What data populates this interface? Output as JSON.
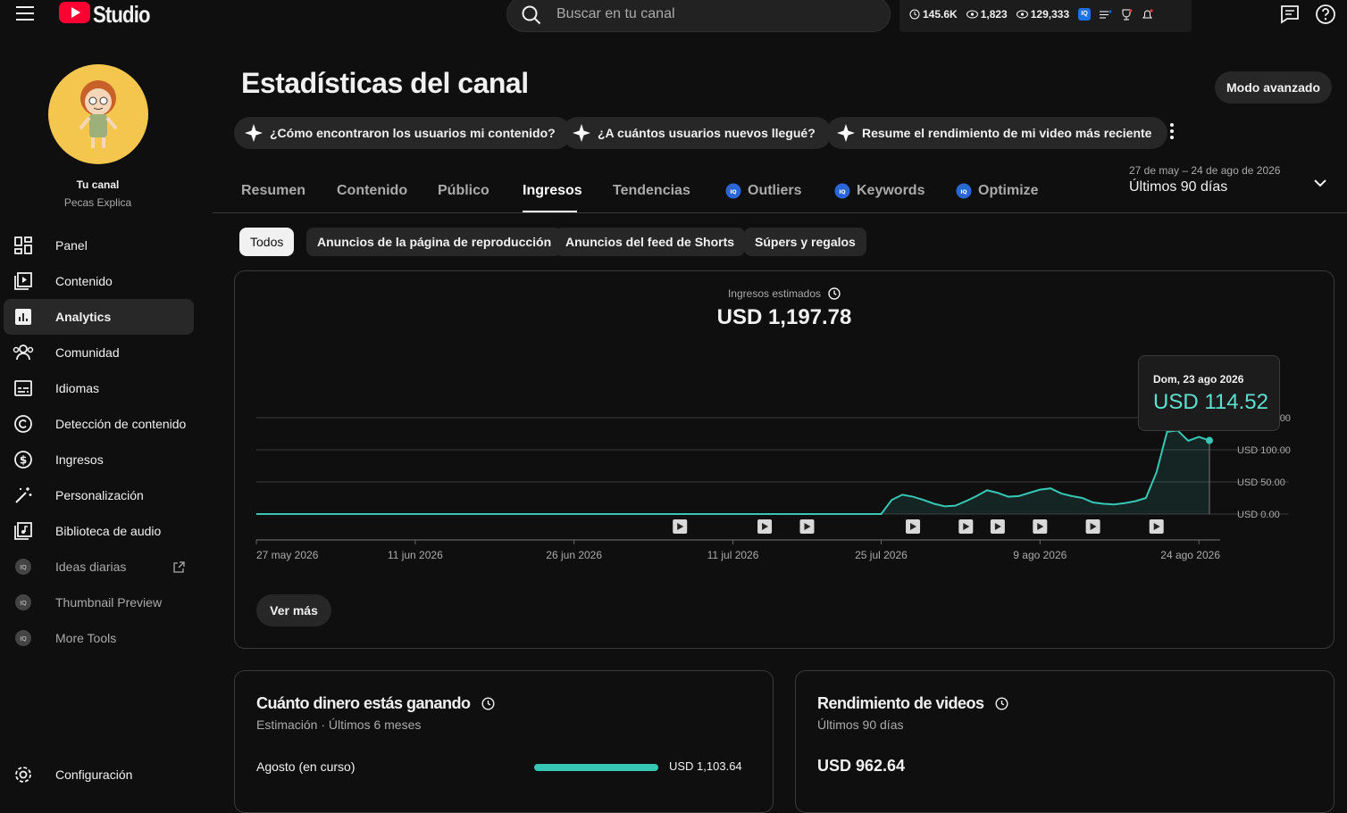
{
  "header": {
    "logo_text": "Studio",
    "search_placeholder": "Buscar en tu canal",
    "stats": {
      "subs": "145.6K",
      "views_a": "1,823",
      "views_b": "129,333",
      "ext_badge": "IQ"
    }
  },
  "channel": {
    "title": "Tu canal",
    "name": "Pecas Explica"
  },
  "sidebar": {
    "items": [
      {
        "label": "Panel",
        "icon": "dashboard-icon"
      },
      {
        "label": "Contenido",
        "icon": "content-icon"
      },
      {
        "label": "Analytics",
        "icon": "analytics-icon",
        "active": true
      },
      {
        "label": "Comunidad",
        "icon": "community-icon"
      },
      {
        "label": "Idiomas",
        "icon": "subtitles-icon"
      },
      {
        "label": "Detección de contenido",
        "icon": "copyright-icon"
      },
      {
        "label": "Ingresos",
        "icon": "dollar-icon"
      },
      {
        "label": "Personalización",
        "icon": "magic-wand-icon"
      },
      {
        "label": "Biblioteca de audio",
        "icon": "audio-library-icon"
      },
      {
        "label": "Ideas diarias",
        "icon": "iq-icon"
      },
      {
        "label": "Thumbnail Preview",
        "icon": "iq-icon"
      },
      {
        "label": "More Tools",
        "icon": "iq-icon"
      }
    ],
    "settings_label": "Configuración"
  },
  "page": {
    "title": "Estadísticas del canal",
    "advanced_mode": "Modo avanzado",
    "suggestions": [
      "¿Cómo encontraron los usuarios mi contenido?",
      "¿A cuántos usuarios nuevos llegué?",
      "Resume el rendimiento de mi video más reciente"
    ],
    "tabs": [
      "Resumen",
      "Contenido",
      "Público",
      "Ingresos",
      "Tendencias",
      "Outliers",
      "Keywords",
      "Optimize"
    ],
    "active_tab": "Ingresos",
    "date_range": "27 de may – 24 de ago de 2026",
    "date_label": "Últimos 90 días",
    "filters": [
      "Todos",
      "Anuncios de la página de reproducción",
      "Anuncios del feed de Shorts",
      "Súpers y regalos"
    ],
    "active_filter": "Todos"
  },
  "revenue_card": {
    "label": "Ingresos estimados",
    "value": "USD 1,197.78",
    "tooltip_date": "Dom, 23 ago 2026",
    "tooltip_value": "USD 114.52",
    "more_button": "Ver más"
  },
  "chart_data": {
    "type": "area",
    "title": "Ingresos estimados",
    "y_tick_labels": [
      "USD 0.00",
      "USD 50.00",
      "USD 100.00",
      "USD 150.00"
    ],
    "y_ticks": [
      0,
      50,
      100,
      150
    ],
    "ylim": [
      0,
      150
    ],
    "x_tick_labels": [
      "27 may 2026",
      "11 jun 2026",
      "26 jun 2026",
      "11 jul 2026",
      "25 jul 2026",
      "9 ago 2026",
      "24 ago 2026"
    ],
    "x_tick_days": [
      0,
      15,
      30,
      45,
      59,
      74,
      89
    ],
    "series": [
      {
        "values": [
          0,
          0,
          0,
          0,
          0,
          0,
          0,
          0,
          0,
          0,
          0,
          0,
          0,
          0,
          0,
          0,
          0,
          0,
          0,
          0,
          0,
          0,
          0,
          0,
          0,
          0,
          0,
          0,
          0,
          0,
          0,
          0,
          0,
          0,
          0,
          0,
          0,
          0,
          0,
          0,
          0,
          0,
          0,
          0,
          0,
          0,
          0,
          0,
          0,
          0,
          0,
          0,
          0,
          0,
          0,
          0,
          0,
          0,
          0,
          0,
          22,
          30,
          27,
          22,
          16,
          12,
          13,
          20,
          28,
          37,
          33,
          27,
          28,
          33,
          38,
          40,
          32,
          28,
          25,
          18,
          16,
          15,
          17,
          20,
          25,
          65,
          128,
          130,
          114,
          120,
          114.52
        ],
        "color": "#37c8b5"
      }
    ],
    "upload_marker_days": [
      40,
      48,
      52,
      62,
      67,
      70,
      74,
      79,
      85
    ]
  },
  "earnings_card": {
    "title": "Cuánto dinero estás ganando",
    "subtitle": "Estimación · Últimos 6 meses",
    "rows": [
      {
        "label": "Agosto (en curso)",
        "value": "USD 1,103.64",
        "fraction": 1.0
      }
    ]
  },
  "videos_card": {
    "title": "Rendimiento de videos",
    "subtitle": "Últimos 90 días",
    "value": "USD 962.64"
  },
  "colors": {
    "accent": "#37c8b5",
    "youtube_red": "#ff0033"
  }
}
